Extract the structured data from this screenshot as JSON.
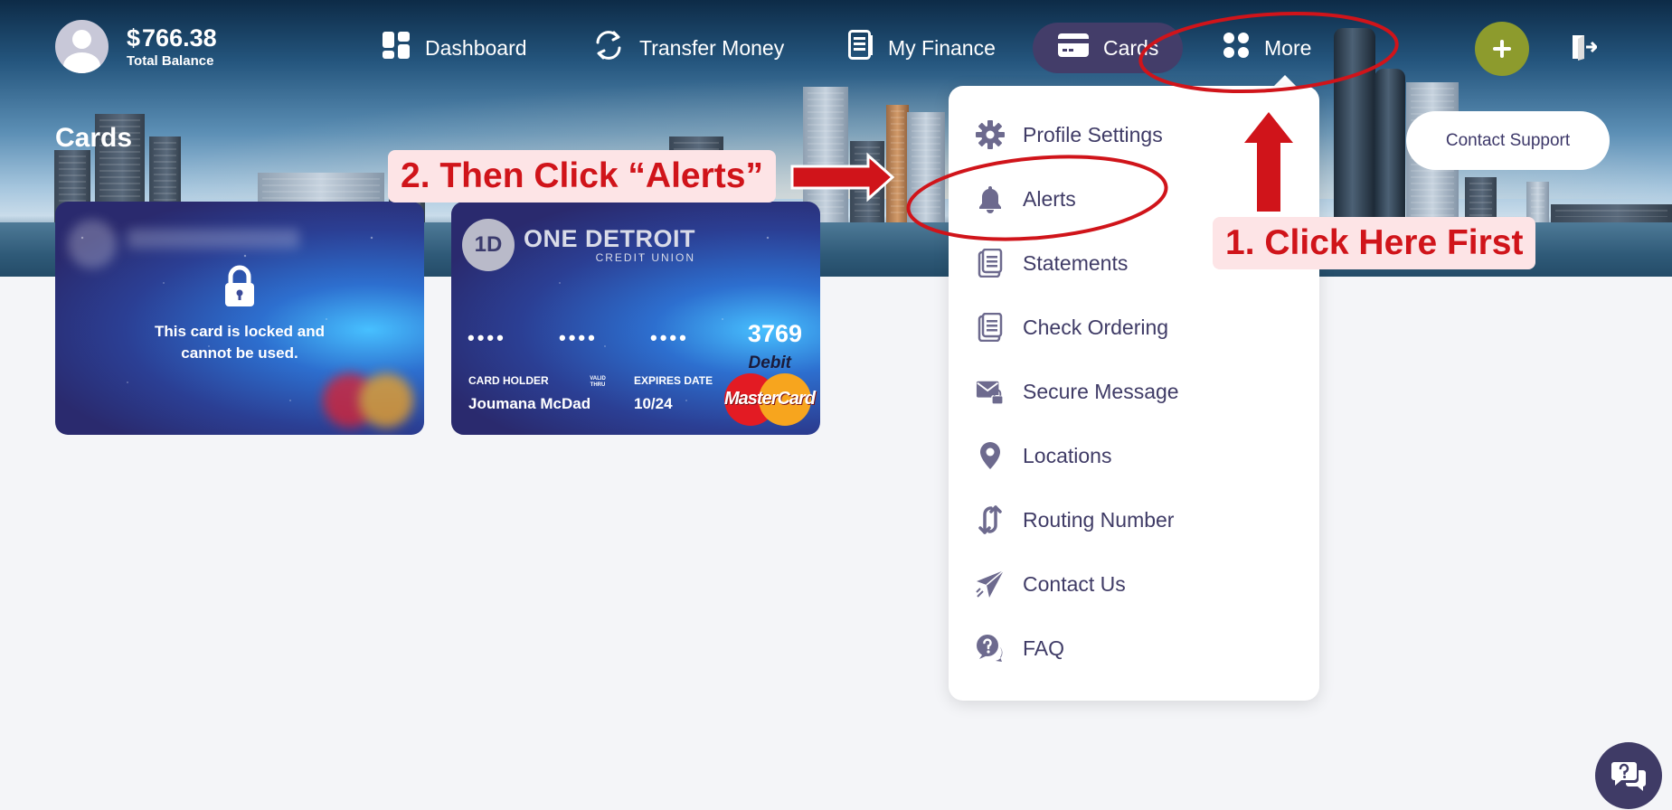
{
  "header": {
    "balance_currency": "$",
    "balance_amount": "766.38",
    "balance_label": "Total Balance",
    "avatar_icon": "user-icon"
  },
  "nav": {
    "dashboard": "Dashboard",
    "transfer": "Transfer Money",
    "finance": "My Finance",
    "cards": "Cards",
    "more": "More"
  },
  "actions": {
    "add_icon": "plus-icon",
    "logout_icon": "logout-icon",
    "contact_support": "Contact Support"
  },
  "page": {
    "title": "Cards"
  },
  "cards": [
    {
      "locked": true,
      "lock_message": "This card is locked and cannot be used."
    },
    {
      "brand_logo": "1D",
      "brand_name": "ONE DETROIT",
      "brand_sub": "CREDIT UNION",
      "masked": [
        "••••",
        "••••",
        "••••"
      ],
      "last4": "3769",
      "holder_label": "CARD HOLDER",
      "holder_name": "Joumana McDad",
      "valid_thru": "VALID THRU",
      "expires_label": "EXPIRES DATE",
      "expires_value": "10/24",
      "type": "Debit",
      "network": "MasterCard"
    }
  ],
  "menu": {
    "items": [
      {
        "label": "Profile Settings",
        "icon": "gear-icon"
      },
      {
        "label": "Alerts",
        "icon": "bell-icon"
      },
      {
        "label": "Statements",
        "icon": "document-icon"
      },
      {
        "label": "Check Ordering",
        "icon": "document-icon"
      },
      {
        "label": "Secure Message",
        "icon": "envelope-lock-icon"
      },
      {
        "label": "Locations",
        "icon": "map-pin-icon"
      },
      {
        "label": "Routing Number",
        "icon": "swap-arrows-icon"
      },
      {
        "label": "Contact Us",
        "icon": "paper-plane-icon"
      },
      {
        "label": "FAQ",
        "icon": "question-chat-icon"
      }
    ]
  },
  "annotations": {
    "step1": "1. Click Here First",
    "step2": "2. Then Click “Alerts”",
    "color": "#d0141a"
  },
  "colors": {
    "primary": "#3f3b66",
    "accent_green": "#8d9b2d"
  },
  "chat": {
    "icon": "help-chat-icon"
  }
}
